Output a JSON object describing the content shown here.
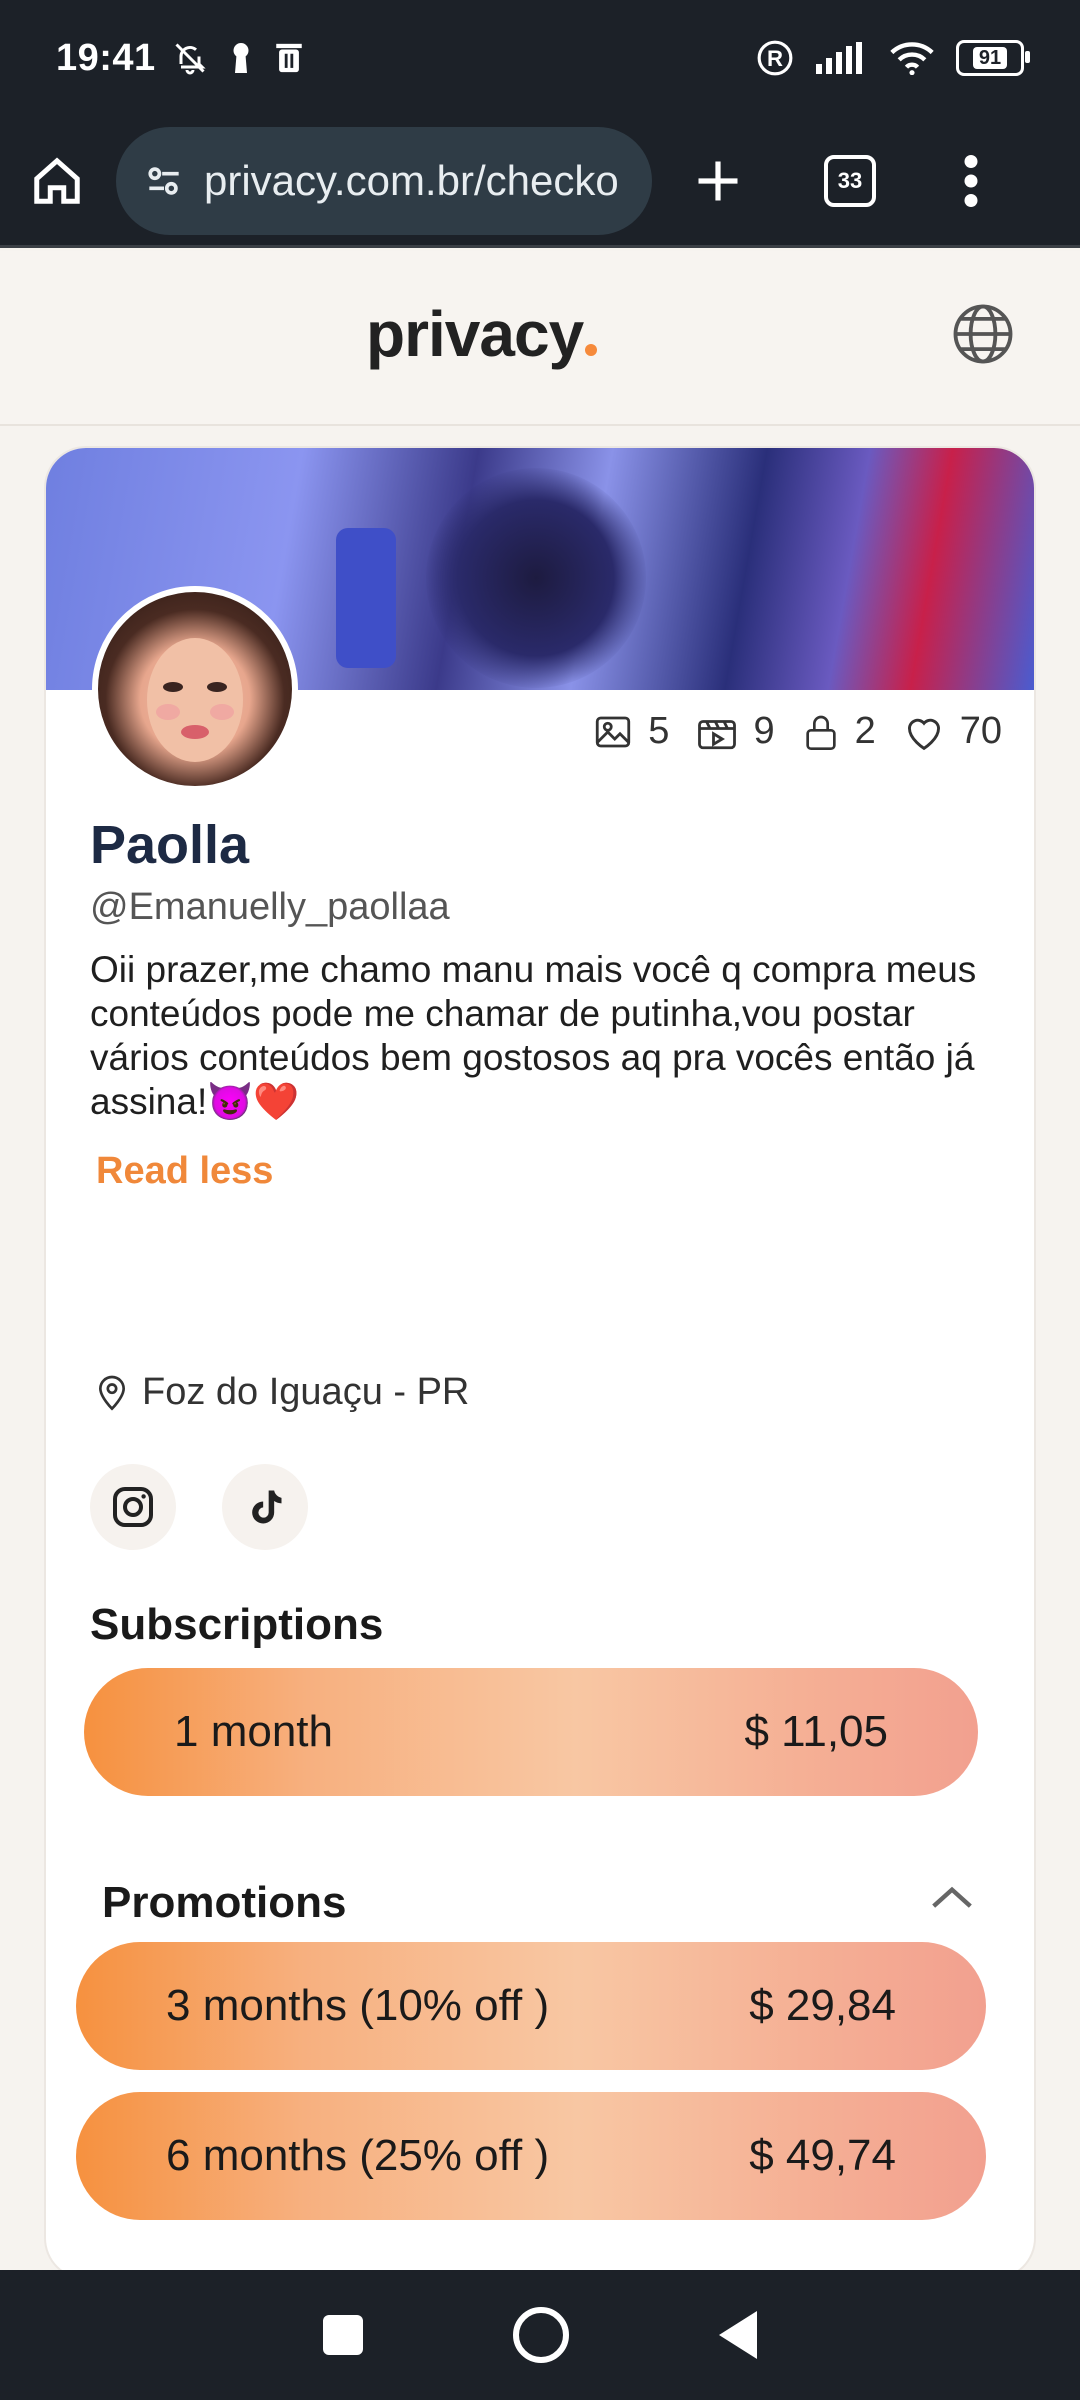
{
  "status_bar": {
    "time": "19:41",
    "battery": "91"
  },
  "browser": {
    "url": "privacy.com.br/checko",
    "tab_count": "33"
  },
  "site": {
    "logo": "privacy"
  },
  "profile": {
    "stats": {
      "images": "5",
      "videos": "9",
      "locked": "2",
      "likes": "70"
    },
    "name": "Paolla",
    "handle": "@Emanuelly_paollaa",
    "bio": "Oii prazer,me chamo manu mais você q compra meus conteúdos pode me chamar de putinha,vou postar vários conteúdos bem gostosos aq pra vocês então já assina!😈❤️",
    "read_less": "Read less",
    "location": "Foz do Iguaçu - PR"
  },
  "subscriptions": {
    "title": "Subscriptions",
    "plans": [
      {
        "label": "1 month",
        "price": "$ 11,05"
      }
    ]
  },
  "promotions": {
    "title": "Promotions",
    "plans": [
      {
        "label": "3 months (10% off )",
        "price": "$ 29,84"
      },
      {
        "label": "6 months (25% off )",
        "price": "$ 49,74"
      }
    ]
  },
  "colors": {
    "accent": "#f0883a",
    "dark": "#1c2128",
    "name": "#1d2a44"
  }
}
